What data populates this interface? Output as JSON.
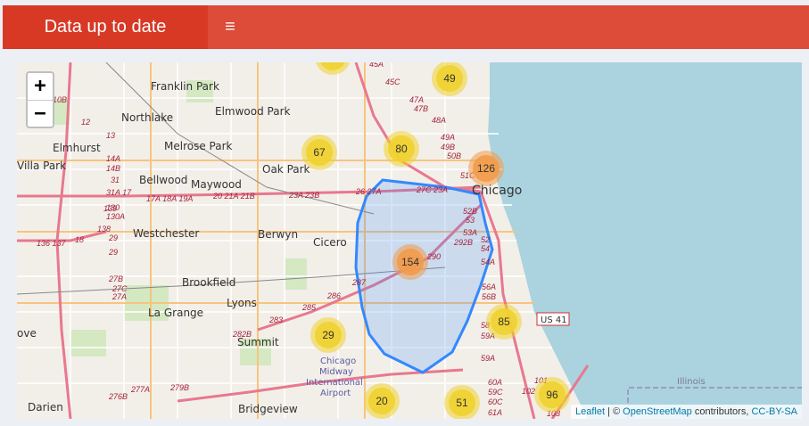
{
  "header": {
    "title": "Data up to date",
    "menu_icon": "hamburger-icon",
    "menu_glyph": "≡"
  },
  "map": {
    "zoom_in": "+",
    "zoom_out": "−",
    "attribution": {
      "leaflet": "Leaflet",
      "separator": " | © ",
      "osm": "OpenStreetMap",
      "contributors": " contributors, ",
      "license": "CC-BY-SA"
    },
    "colors": {
      "cluster_small": "#f0d12e",
      "cluster_medium": "#f29b4a",
      "polygon": "#3388ff",
      "water": "#aad3df"
    },
    "places": [
      "Franklin Park",
      "Elmwood Park",
      "Northlake",
      "Elmhurst",
      "Melrose Park",
      "Villa Park",
      "Oak Park",
      "Bellwood",
      "Maywood",
      "Chicago",
      "Westchester",
      "Berwyn",
      "Cicero",
      "Brookfield",
      "La Grange",
      "Lyons",
      "Summit",
      "Chicago Midway International Airport",
      "Bridgeview",
      "Darien",
      "ove",
      "Illinois",
      "US 41"
    ],
    "exits": [
      "10B",
      "12",
      "13",
      "14A",
      "14B",
      "31",
      "31A",
      "17",
      "17A",
      "18A",
      "19A",
      "20",
      "21A",
      "21B",
      "23A",
      "23B",
      "26",
      "27A",
      "27C",
      "23A",
      "45A",
      "45C",
      "47A",
      "47B",
      "48A",
      "49A",
      "49B",
      "50B",
      "51C",
      "52B",
      "53",
      "53A",
      "292B",
      "52",
      "54",
      "54A",
      "55A",
      "56A",
      "56B",
      "58",
      "59A",
      "59C",
      "60A",
      "60C",
      "61A",
      "102",
      "103",
      "101",
      "130",
      "130A",
      "139",
      "138",
      "136",
      "137",
      "18",
      "29",
      "27B",
      "27C",
      "27A",
      "28",
      "29",
      "290",
      "287",
      "286",
      "285",
      "283",
      "282B",
      "277A",
      "279B",
      "276B"
    ],
    "clusters": [
      {
        "label": "",
        "size": "small"
      },
      {
        "label": "49",
        "size": "small"
      },
      {
        "label": "67",
        "size": "small"
      },
      {
        "label": "80",
        "size": "small"
      },
      {
        "label": "126",
        "size": "medium"
      },
      {
        "label": "154",
        "size": "medium"
      },
      {
        "label": "85",
        "size": "small"
      },
      {
        "label": "29",
        "size": "small"
      },
      {
        "label": "20",
        "size": "small"
      },
      {
        "label": "51",
        "size": "small"
      },
      {
        "label": "96",
        "size": "small"
      }
    ]
  }
}
